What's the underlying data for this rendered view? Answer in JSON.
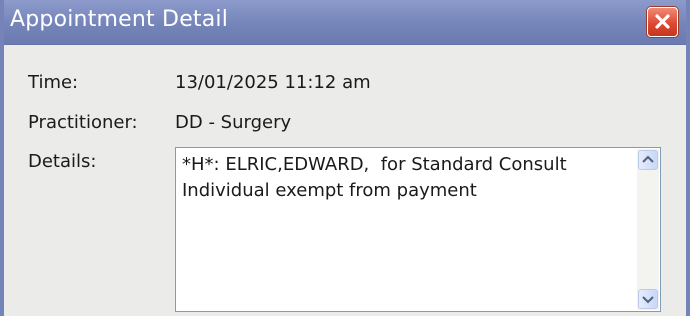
{
  "window": {
    "title": "Appointment Detail"
  },
  "fields": {
    "time_label": "Time:",
    "time_value": "13/01/2025 11:12 am",
    "practitioner_label": "Practitioner:",
    "practitioner_value": "DD - Surgery",
    "details_label": "Details:",
    "details_value": "*H*: ELRIC,EDWARD,  for Standard Consult\nIndividual exempt from payment"
  },
  "icons": {
    "close": "close-icon",
    "scroll_up": "chevron-up-icon",
    "scroll_down": "chevron-down-icon"
  },
  "colors": {
    "titlebar": "#7585b9",
    "close_button": "#dd4a34",
    "client_background": "#ebebea",
    "textbox_border": "#7f9db9"
  }
}
